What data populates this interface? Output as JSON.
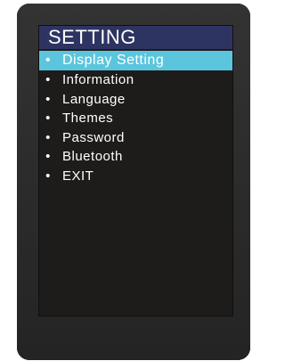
{
  "screen": {
    "title": "SETTING",
    "bullet_glyph": "•",
    "menu": [
      {
        "label": "Display Setting",
        "selected": true
      },
      {
        "label": "Information",
        "selected": false
      },
      {
        "label": "Language",
        "selected": false
      },
      {
        "label": "Themes",
        "selected": false
      },
      {
        "label": "Password",
        "selected": false
      },
      {
        "label": "Bluetooth",
        "selected": false
      },
      {
        "label": "EXIT",
        "selected": false
      }
    ]
  },
  "colors": {
    "device_body": "#2b2b2b",
    "screen_background": "#1d1c1a",
    "title_bar": "#2e3462",
    "selection_highlight": "#5bc5dd",
    "text": "#ffffff"
  }
}
